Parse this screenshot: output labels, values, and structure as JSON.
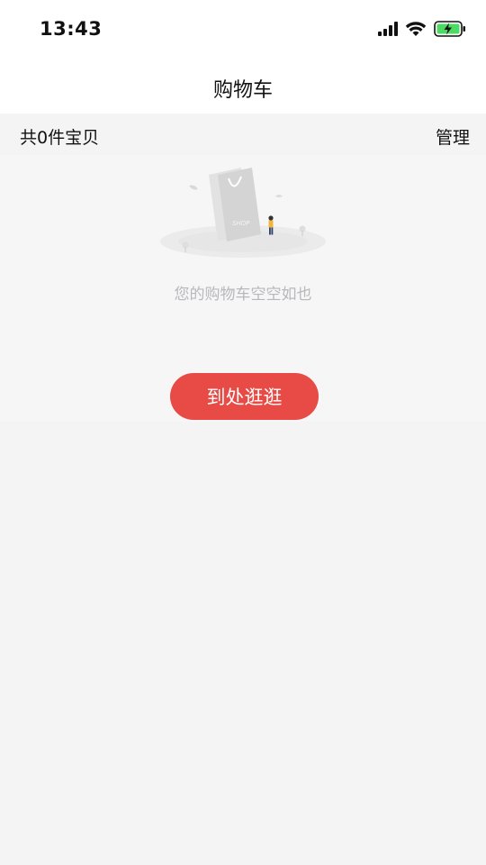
{
  "status_bar": {
    "time": "13:43",
    "icons": [
      "signal-icon",
      "wifi-icon",
      "battery-charging-icon"
    ]
  },
  "nav": {
    "title": "购物车"
  },
  "cart": {
    "item_count_label": "共0件宝贝",
    "manage_label": "管理",
    "empty_message": "您的购物车空空如也",
    "go_shopping_label": "到处逛逛",
    "illustration_bag_text": "SHOP"
  },
  "colors": {
    "accent": "#e84a46",
    "background": "#f4f4f4",
    "muted_text": "#b8b8bc",
    "battery_green": "#4cd964"
  }
}
